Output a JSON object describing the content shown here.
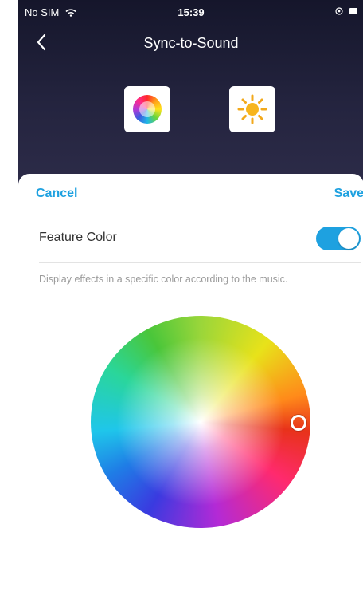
{
  "status_bar": {
    "carrier": "No SIM",
    "time": "15:39"
  },
  "nav": {
    "title": "Sync-to-Sound"
  },
  "mode_tiles": {
    "color_icon": "color-wheel-icon",
    "brightness_icon": "sun-icon"
  },
  "sheet": {
    "cancel_label": "Cancel",
    "save_label": "Save",
    "feature_color_label": "Feature Color",
    "feature_color_enabled": true,
    "description": "Display effects in a specific color according to the music."
  },
  "colors": {
    "accent": "#1ea1e0",
    "header_bg": "#1f1f38"
  },
  "color_wheel": {
    "selected_icon": "picker-handle-icon"
  }
}
